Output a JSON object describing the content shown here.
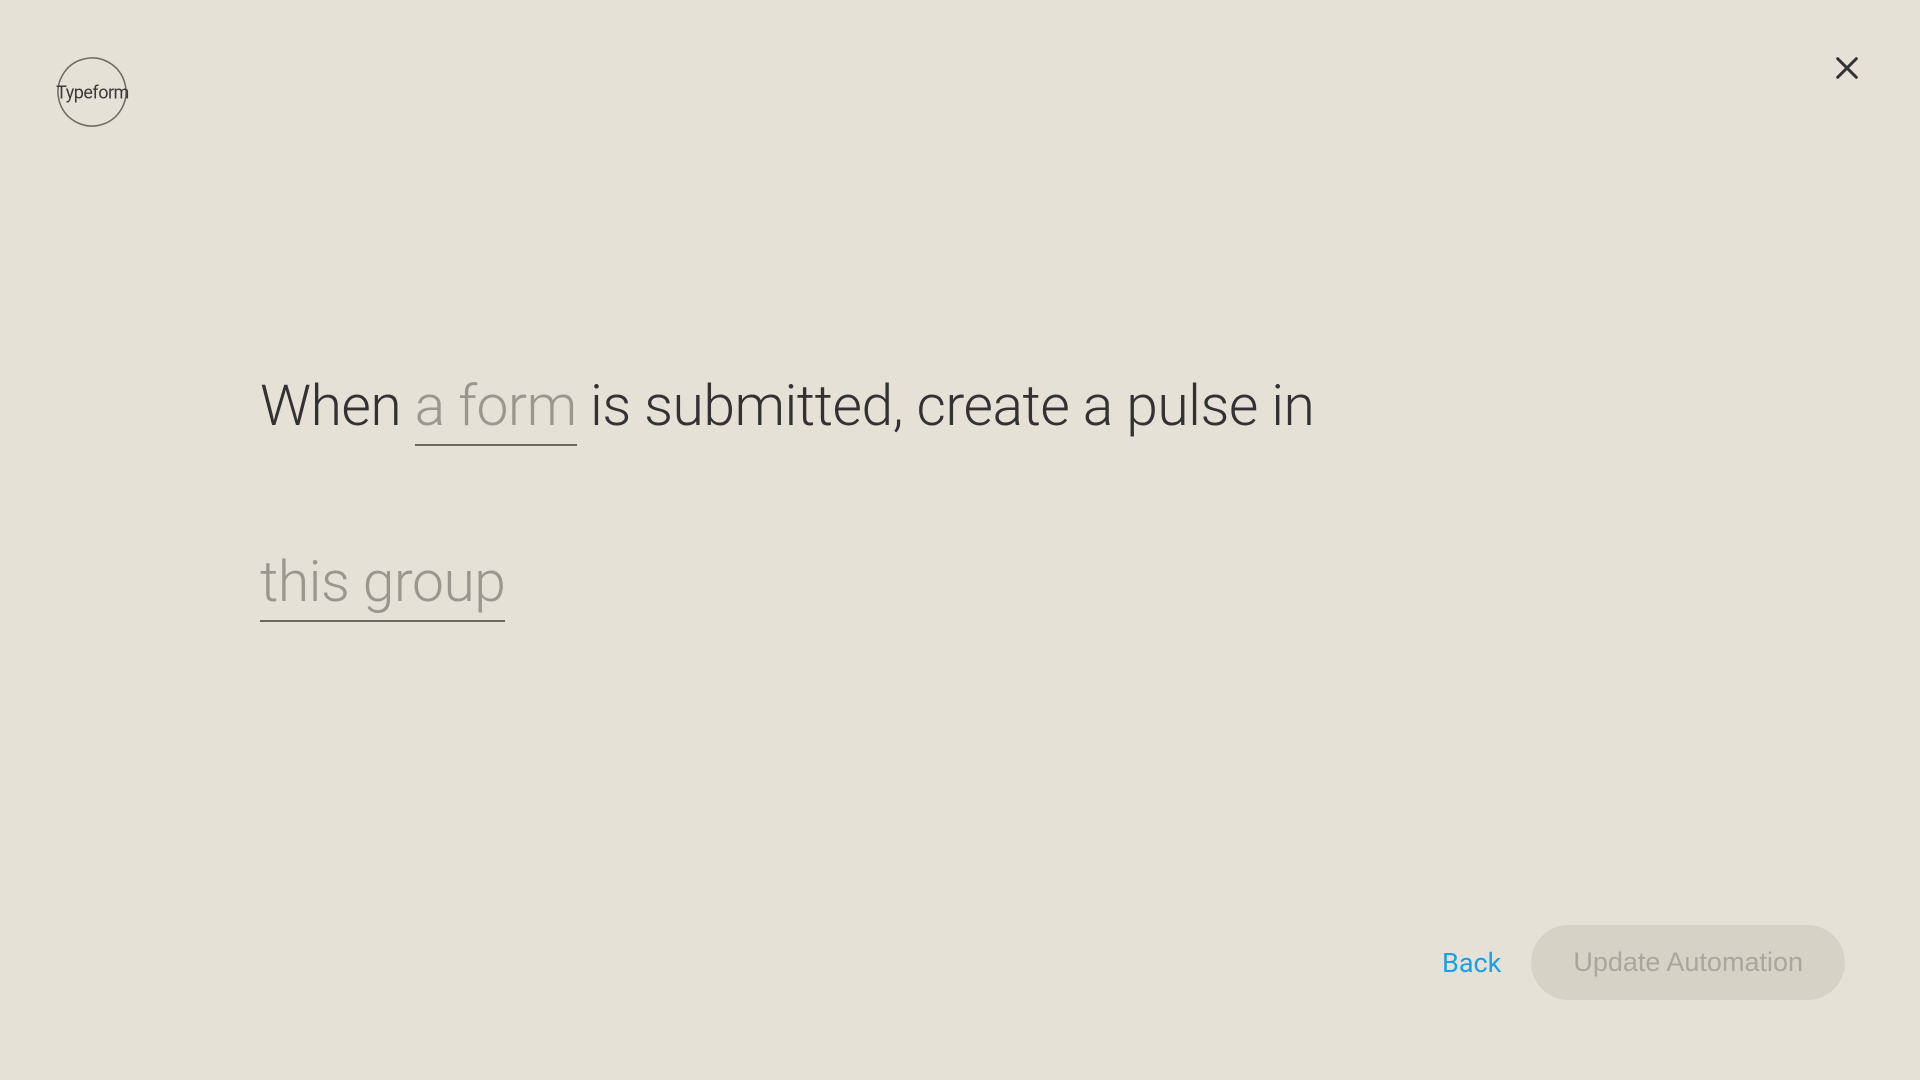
{
  "logo": {
    "text": "Typeform"
  },
  "sentence": {
    "prefix": "When ",
    "form_placeholder": "a form",
    "middle": " is submitted, create a pulse in",
    "group_placeholder": "this group"
  },
  "footer": {
    "back_label": "Back",
    "update_label": "Update Automation"
  }
}
